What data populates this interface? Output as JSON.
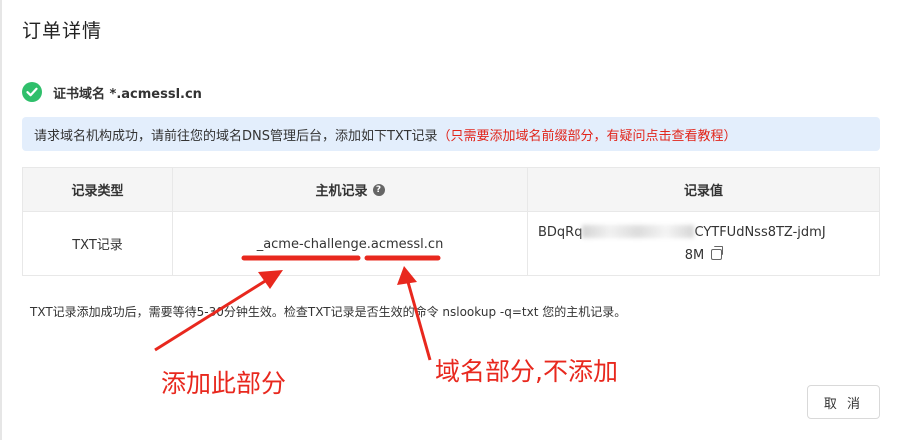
{
  "dialog": {
    "title": "订单详情",
    "cancel_label": "取 消"
  },
  "certificate": {
    "label": "证书域名 *.acmessl.cn",
    "status_icon": "check-circle-icon",
    "status_color": "#2fbf6b"
  },
  "alert": {
    "text": "请求域名机构成功，请前往您的域名DNS管理后台，添加如下TXT记录",
    "highlight": "（只需要添加域名前缀部分，有疑问点击查看教程）",
    "highlight_color": "#e1251b",
    "background_color": "#e3eefc"
  },
  "table": {
    "headers": {
      "type": "记录类型",
      "host": "主机记录",
      "value": "记录值"
    },
    "host_help_icon": "question-circle-icon",
    "rows": [
      {
        "type": "TXT记录",
        "host": "_acme-challenge.acmessl.cn",
        "value_start": "BDqRq",
        "value_end": "CYTFUdNss8TZ-jdmJ",
        "value_last": "8M",
        "copy_icon": "copy-icon"
      }
    ]
  },
  "note": "TXT记录添加成功后，需要等待5-30分钟生效。检查TXT记录是否生效的命令 nslookup -q=txt 您的主机记录。",
  "annotations": {
    "add_prefix": "添加此部分",
    "domain_part": "域名部分,不添加",
    "color": "#e8281e"
  }
}
